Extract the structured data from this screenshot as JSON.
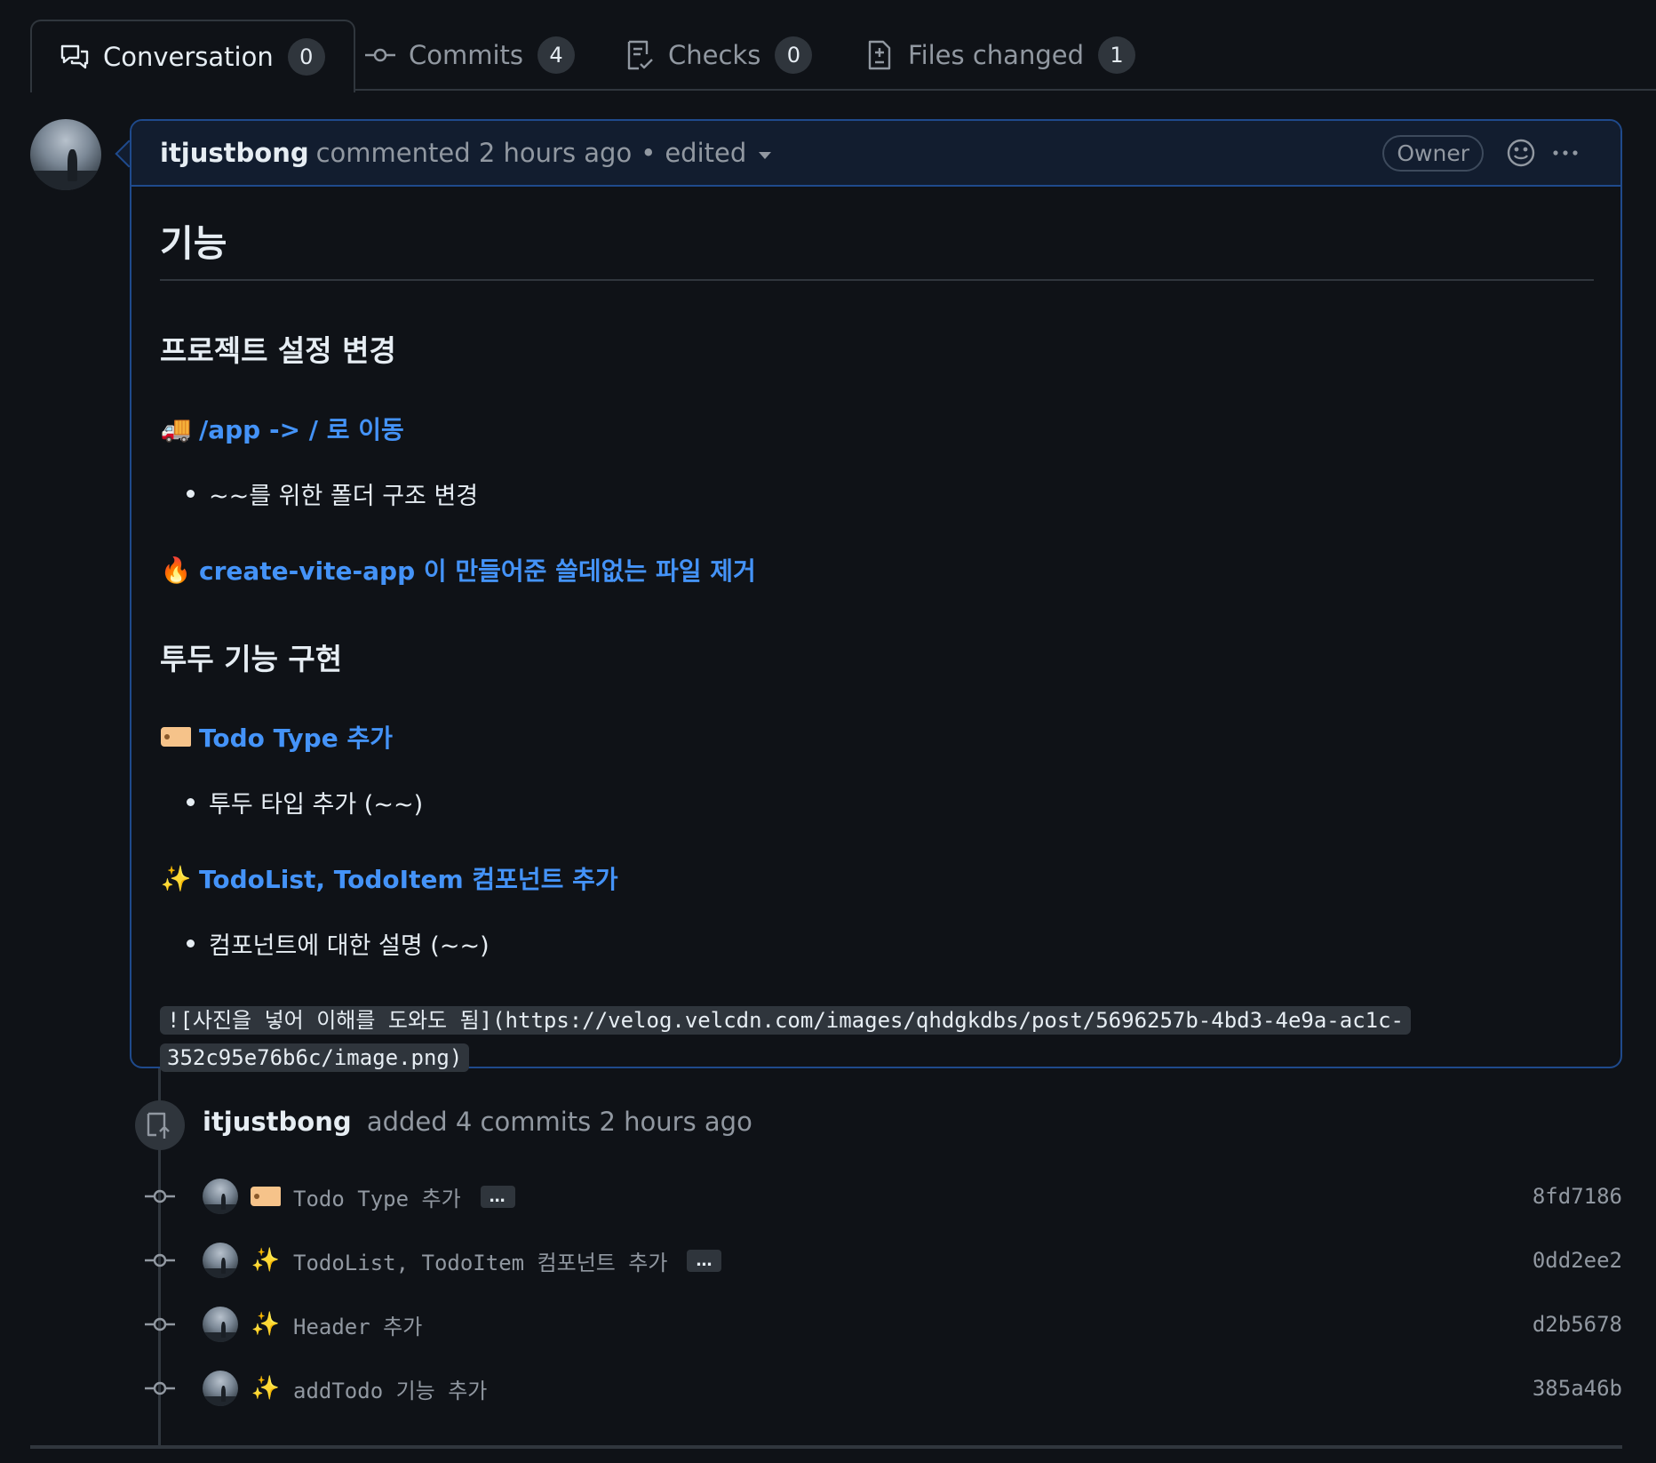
{
  "tabs": [
    {
      "label": "Conversation",
      "count": "0",
      "icon": "comment-discussion-icon"
    },
    {
      "label": "Commits",
      "count": "4",
      "icon": "git-commit-icon"
    },
    {
      "label": "Checks",
      "count": "0",
      "icon": "checklist-icon"
    },
    {
      "label": "Files changed",
      "count": "1",
      "icon": "file-diff-icon"
    }
  ],
  "comment": {
    "author": "itjustbong",
    "meta": "commented 2 hours ago",
    "separator": "•",
    "edited": "edited",
    "badge": "Owner",
    "body": {
      "h1": "기능",
      "section1_title": "프로젝트 설정 변경",
      "item1_emoji": "🚚",
      "item1_title": "/app -> / 로 이동",
      "item1_bullet": "~~를 위한 폴더 구조 변경",
      "item2_emoji": "🔥",
      "item2_title": "create-vite-app 이 만들어준 쓸데없는 파일 제거",
      "section2_title": "투두 기능 구현",
      "item3_emoji": "🏷️",
      "item3_title": "Todo Type 추가",
      "item3_bullet": "투두 타입 추가 (~~)",
      "item4_emoji": "✨",
      "item4_title": "TodoList, TodoItem 컴포넌트 추가",
      "item4_bullet": "컴포넌트에 대한 설명 (~~)",
      "code_line1": "![사진을 넣어 이해를 도와도 됨](https://velog.velcdn.com/images/qhdgkdbs/post/5696257b-4bd3-4e9a-ac1c-",
      "code_line2": "352c95e76b6c/image.png)"
    }
  },
  "push_event": {
    "author": "itjustbong",
    "text": "added 4 commits 2 hours ago"
  },
  "commits": [
    {
      "emoji": "🏷️",
      "message": "Todo Type 추가",
      "has_more": true,
      "more_label": "…",
      "sha": "8fd7186"
    },
    {
      "emoji": "✨",
      "message": "TodoList, TodoItem 컴포넌트 추가",
      "has_more": true,
      "more_label": "…",
      "sha": "0dd2ee2"
    },
    {
      "emoji": "✨",
      "message": "Header 추가",
      "has_more": false,
      "sha": "d2b5678"
    },
    {
      "emoji": "✨",
      "message": "addTodo 기능 추가",
      "has_more": false,
      "sha": "385a46b"
    }
  ],
  "colors": {
    "background": "#0f1217",
    "accent_link": "#4493f8",
    "border_highlight": "#1f4a8c",
    "muted_text": "#9198a1"
  }
}
